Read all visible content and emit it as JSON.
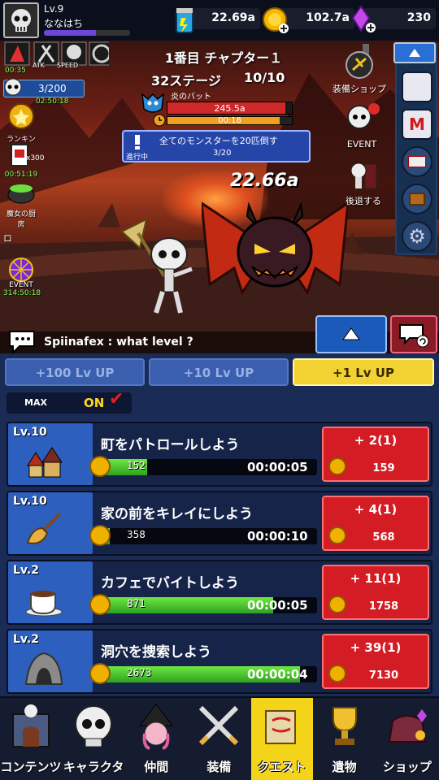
{
  "player": {
    "level": "Lv.9",
    "name": "ななはち",
    "xp_fraction": 0.6
  },
  "currencies": [
    {
      "icon": "potion-can-icon",
      "value": "22.69a"
    },
    {
      "icon": "gold-coin-icon",
      "value": "102.7a"
    },
    {
      "icon": "purple-gem-icon",
      "value": "230"
    }
  ],
  "stage": {
    "chapter": "1番目 チャプター１",
    "stage": "32ステージ",
    "count": "10/10",
    "boss_name": "炎のバット",
    "boss_hp": "245.5a",
    "boss_hp_fraction": 0.95,
    "boss_timer": "00:18",
    "boss_timer_fraction": 0.9,
    "damage": "22.66a"
  },
  "mission": {
    "text": "全てのモンスターを20匹倒す",
    "progress": "3/20",
    "state": "進行中"
  },
  "left_buttons": {
    "timer1": "00:35",
    "counter": "3/200",
    "counter_timer": "02:50:18",
    "ranking": "ランキング",
    "card_count": "x300",
    "card_timer": "00:51:19",
    "witch": "魔女の厨房",
    "event": "EVENT",
    "event_timer": "314:50:18",
    "atk": "ATK",
    "speed": "SPEED",
    "rogue": "ロ"
  },
  "right_buttons": {
    "equip_shop": "装備ショップ",
    "event": "EVENT",
    "retreat": "後退する"
  },
  "chat": {
    "message": "Spiinafex : what level ?"
  },
  "level_up": {
    "b100": "+100 Lv UP",
    "b10": "+10 Lv UP",
    "b1": "+1 Lv UP"
  },
  "max_toggle": {
    "label": "MAX",
    "state": "ON"
  },
  "quests": [
    {
      "level": "Lv.10",
      "icon": "village-houses-icon",
      "title": "町をパトロールしよう",
      "value": "152",
      "progress": 0.22,
      "time": "00:00:05",
      "reward": "+ 2(1)",
      "cost": "159"
    },
    {
      "level": "Lv.10",
      "icon": "broom-icon",
      "title": "家の前をキレイにしよう",
      "value": "358",
      "progress": 0.05,
      "time": "00:00:10",
      "reward": "+ 4(1)",
      "cost": "568"
    },
    {
      "level": "Lv.2",
      "icon": "coffee-cup-icon",
      "title": "カフェでバイトしよう",
      "value": "871",
      "progress": 0.8,
      "time": "00:00:05",
      "reward": "+ 11(1)",
      "cost": "1758"
    },
    {
      "level": "Lv.2",
      "icon": "cave-icon",
      "title": "洞穴を捜索しよう",
      "value": "2673",
      "progress": 0.92,
      "time": "00:00:04",
      "reward": "+ 39(1)",
      "cost": "7130"
    }
  ],
  "nav": [
    {
      "label": "コンテンツ",
      "icon": "castle-gate-icon"
    },
    {
      "label": "キャラクター",
      "icon": "skull-icon"
    },
    {
      "label": "仲間",
      "icon": "witch-icon"
    },
    {
      "label": "装備",
      "icon": "crossed-swords-icon"
    },
    {
      "label": "クエスト",
      "icon": "quest-scroll-icon"
    },
    {
      "label": "遺物",
      "icon": "trophy-icon"
    },
    {
      "label": "ショップ",
      "icon": "treasure-bag-icon"
    }
  ]
}
